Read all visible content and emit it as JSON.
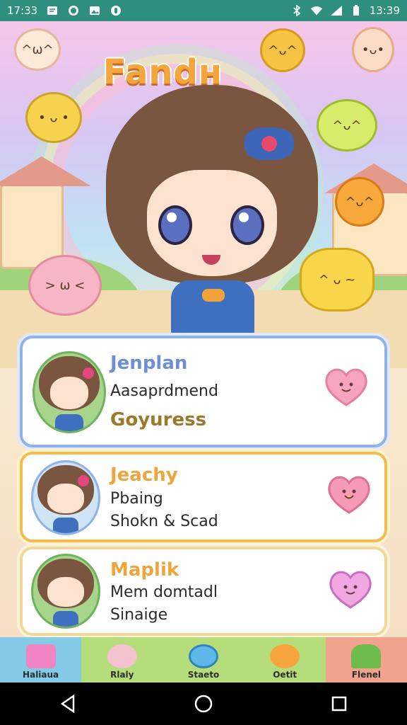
{
  "status_bar": {
    "time_left": "17:33",
    "time_right": "13:39",
    "left_icons": [
      "message-icon",
      "whatsapp-icon",
      "gallery-icon",
      "notification-icon"
    ],
    "right_icons": [
      "bluetooth-icon",
      "wifi-icon",
      "signal-icon",
      "battery-icon"
    ]
  },
  "app": {
    "title": "Fandн"
  },
  "cards": [
    {
      "name": "Jenplan",
      "line1": "Aasaprdmend",
      "line2": "Goyuress",
      "name_color": "#6e8fd6",
      "extra_color": "#9a7a2a"
    },
    {
      "name": "Jeachy",
      "line1": "Pbaing",
      "line2": "Shokn & Scad",
      "name_color": "#f0a53c",
      "extra_color": "#2b2b2b"
    },
    {
      "name": "Maplik",
      "line1": "Mem domtadl",
      "line2": "Sinaige",
      "name_color": "#f0a53c",
      "extra_color": "#2b2b2b"
    }
  ],
  "tabs": [
    {
      "label": "Haliaua",
      "bg": "#84cbe8"
    },
    {
      "label": "Rlaly",
      "bg": "#b5de7b"
    },
    {
      "label": "Staeto",
      "bg": "#b5de7b"
    },
    {
      "label": "Oetit",
      "bg": "#b5de7b"
    },
    {
      "label": "Flenel",
      "bg": "#f2a38e"
    }
  ]
}
